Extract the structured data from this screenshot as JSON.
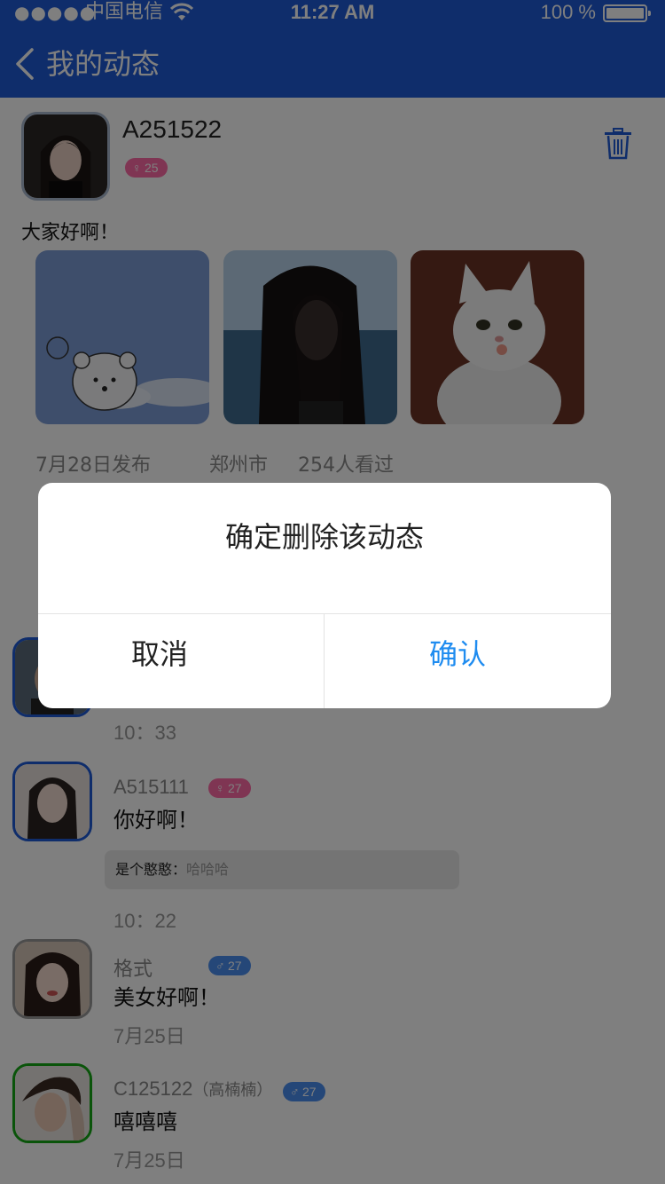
{
  "status_bar": {
    "signal_dots": "●●●●●",
    "carrier": "中国电信",
    "time": "11:27 AM",
    "battery": "100 %"
  },
  "nav": {
    "title": "我的动态"
  },
  "post": {
    "username": "A251522",
    "gender_symbol": "♀",
    "age": "25",
    "text": "大家好啊！",
    "date": "7月28日发布",
    "city": "郑州市",
    "views": "254人看过"
  },
  "comments": [
    {
      "time": "10：33"
    },
    {
      "username": "A515111",
      "gender_symbol": "♀",
      "age": "27",
      "text": "你好啊！",
      "reply": {
        "name": "是个憨憨：",
        "text": "哈哈哈"
      },
      "time": "10：22"
    },
    {
      "username": "格式",
      "gender_symbol": "♂",
      "age": "27",
      "text": "美女好啊！",
      "time": "7月25日"
    },
    {
      "username": "C125122",
      "alias": "（高楠楠）",
      "gender_symbol": "♂",
      "age": "27",
      "text": "嘻嘻嘻",
      "time": "7月25日"
    }
  ],
  "dialog": {
    "message": "确定删除该动态",
    "cancel": "取消",
    "confirm": "确认"
  },
  "colors": {
    "header": "#1e5bd6",
    "confirm": "#1f8cf0",
    "female_badge": "#ff6aa6",
    "male_badge": "#4a8ef0"
  }
}
